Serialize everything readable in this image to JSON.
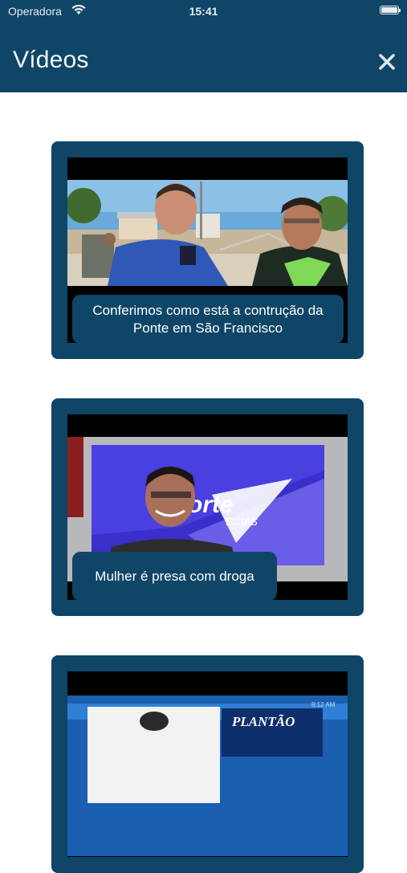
{
  "status_bar": {
    "carrier": "Operadora",
    "time": "15:41"
  },
  "header": {
    "title": "Vídeos"
  },
  "videos": [
    {
      "caption": "Conferimos como está a contrução da Ponte em São Francisco"
    },
    {
      "caption": "Mulher é presa com droga"
    },
    {
      "caption": ""
    }
  ],
  "thumb_texts": {
    "v2_logo_big": "orte",
    "v2_logo_small": "TICIAS",
    "v3_banner": "PLANTÃO",
    "v3_time": "8:12 AM"
  },
  "colors": {
    "primary": "#0f4567",
    "background": "#ffffff",
    "text_on_primary": "#ffffff"
  },
  "icons": {
    "close": "close-icon",
    "wifi": "wifi-icon",
    "battery": "battery-icon"
  }
}
